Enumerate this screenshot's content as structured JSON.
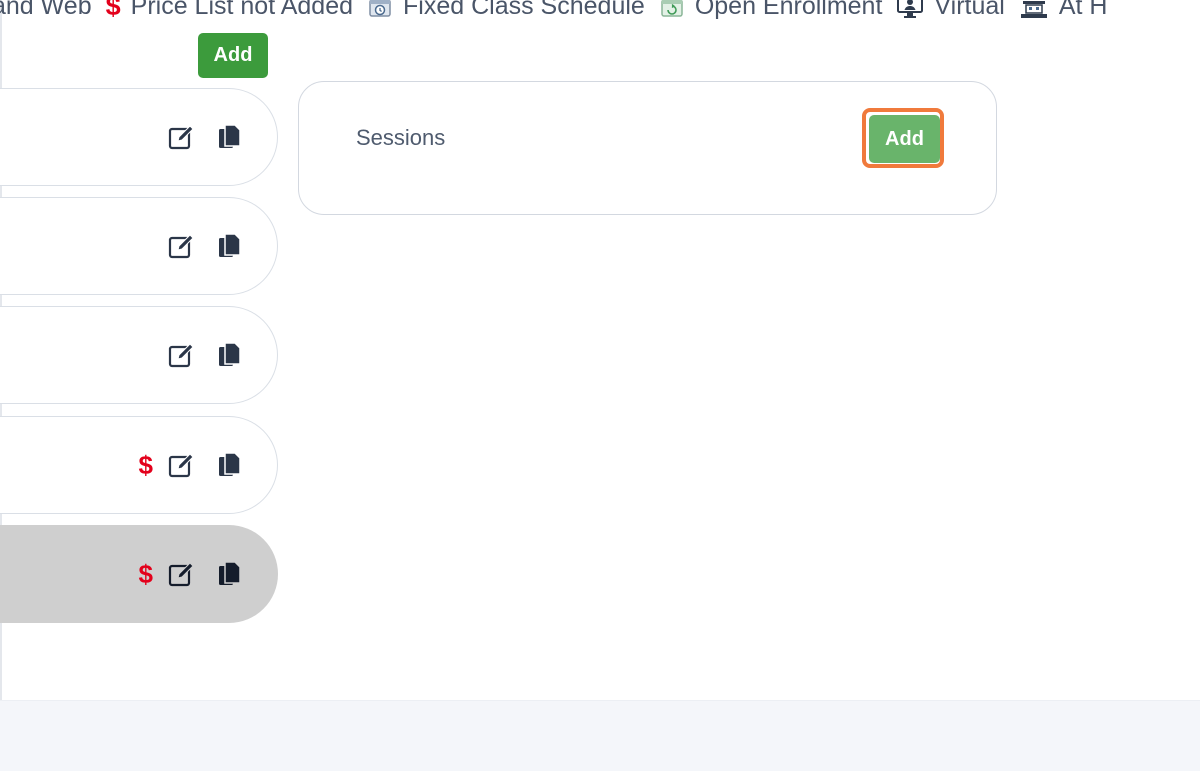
{
  "legend": {
    "items": [
      {
        "label": "and Web",
        "icon": "none"
      },
      {
        "label": "Price List not Added",
        "icon": "dollar-icon",
        "symbol": "$"
      },
      {
        "label": "Fixed Class Schedule",
        "icon": "clock-calendar-icon"
      },
      {
        "label": "Open Enrollment",
        "icon": "calendar-refresh-icon"
      },
      {
        "label": "Virtual",
        "icon": "monitor-user-icon"
      },
      {
        "label": "At H",
        "icon": "building-icon"
      }
    ]
  },
  "list": {
    "add_label": "Add",
    "price_symbol": "$",
    "rows": [
      {
        "price_warning": false,
        "selected": false
      },
      {
        "price_warning": false,
        "selected": false
      },
      {
        "price_warning": false,
        "selected": false
      },
      {
        "price_warning": true,
        "selected": false
      },
      {
        "price_warning": true,
        "selected": true
      }
    ]
  },
  "sessions": {
    "title": "Sessions",
    "add_label": "Add"
  },
  "colors": {
    "add_button": "#3c9b3c",
    "add_button_focused": "#69b46b",
    "focus_ring": "#f07a3c",
    "price_warning": "#e3001b",
    "selected_row": "#cfcfcf"
  }
}
